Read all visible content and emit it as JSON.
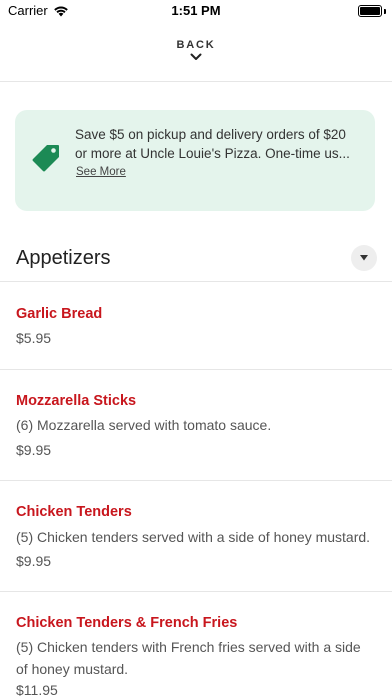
{
  "status_bar": {
    "carrier": "Carrier",
    "time": "1:51 PM"
  },
  "nav": {
    "back_label": "BACK"
  },
  "promo": {
    "text": "Save $5 on pickup and delivery orders of $20 or more at Uncle Louie's Pizza. One-time us...",
    "link_label": "See More"
  },
  "section": {
    "title": "Appetizers"
  },
  "items": [
    {
      "name": "Garlic Bread",
      "description": "",
      "price": "$5.95"
    },
    {
      "name": "Mozzarella Sticks",
      "description": "(6) Mozzarella served with tomato sauce.",
      "price": "$9.95"
    },
    {
      "name": "Chicken Tenders",
      "description": "(5) Chicken tenders served with a side of honey mustard.",
      "price": "$9.95"
    },
    {
      "name": "Chicken Tenders & French Fries",
      "description": "(5) Chicken tenders with French fries served with a side of honey mustard.",
      "price": "$11.95"
    }
  ],
  "colors": {
    "accent_red": "#c8161d",
    "promo_bg": "#e4f4ec",
    "tag_green": "#1c8a55"
  }
}
